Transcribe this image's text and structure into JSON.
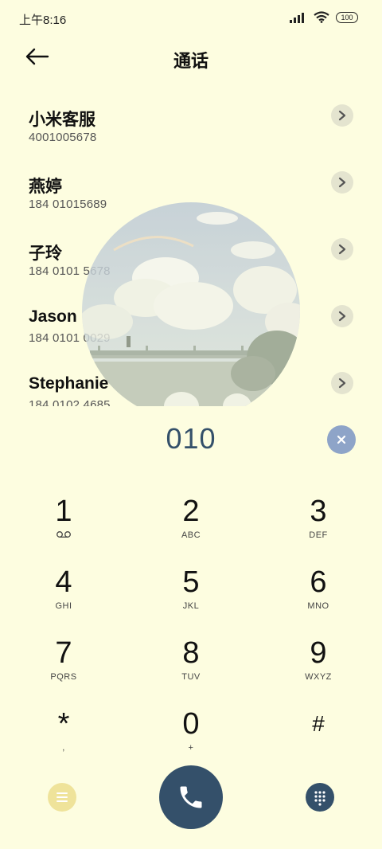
{
  "status": {
    "time": "上午8:16",
    "battery": "100"
  },
  "header": {
    "title": "通话"
  },
  "contacts": [
    {
      "name": "小米客服",
      "number": "4001005678"
    },
    {
      "name": "燕婷",
      "number": "184 01015689"
    },
    {
      "name": "子玲",
      "number": "184 0101 5678"
    },
    {
      "name": "Jason",
      "number": "184 0101 0029"
    },
    {
      "name": "Stephanie",
      "number": "184 0102 4685"
    }
  ],
  "dial": {
    "digits": "010"
  },
  "keypad": [
    {
      "digit": "1",
      "letters": "⌖"
    },
    {
      "digit": "2",
      "letters": "ABC"
    },
    {
      "digit": "3",
      "letters": "DEF"
    },
    {
      "digit": "4",
      "letters": "GHI"
    },
    {
      "digit": "5",
      "letters": "JKL"
    },
    {
      "digit": "6",
      "letters": "MNO"
    },
    {
      "digit": "7",
      "letters": "PQRS"
    },
    {
      "digit": "8",
      "letters": "TUV"
    },
    {
      "digit": "9",
      "letters": "WXYZ"
    },
    {
      "digit": "*",
      "letters": ","
    },
    {
      "digit": "0",
      "letters": "+"
    },
    {
      "digit": "#",
      "letters": ""
    }
  ],
  "colors": {
    "background": "#fdfde0",
    "accent": "#34506a",
    "clear": "#8ea4c8",
    "menu": "#efe39a"
  }
}
